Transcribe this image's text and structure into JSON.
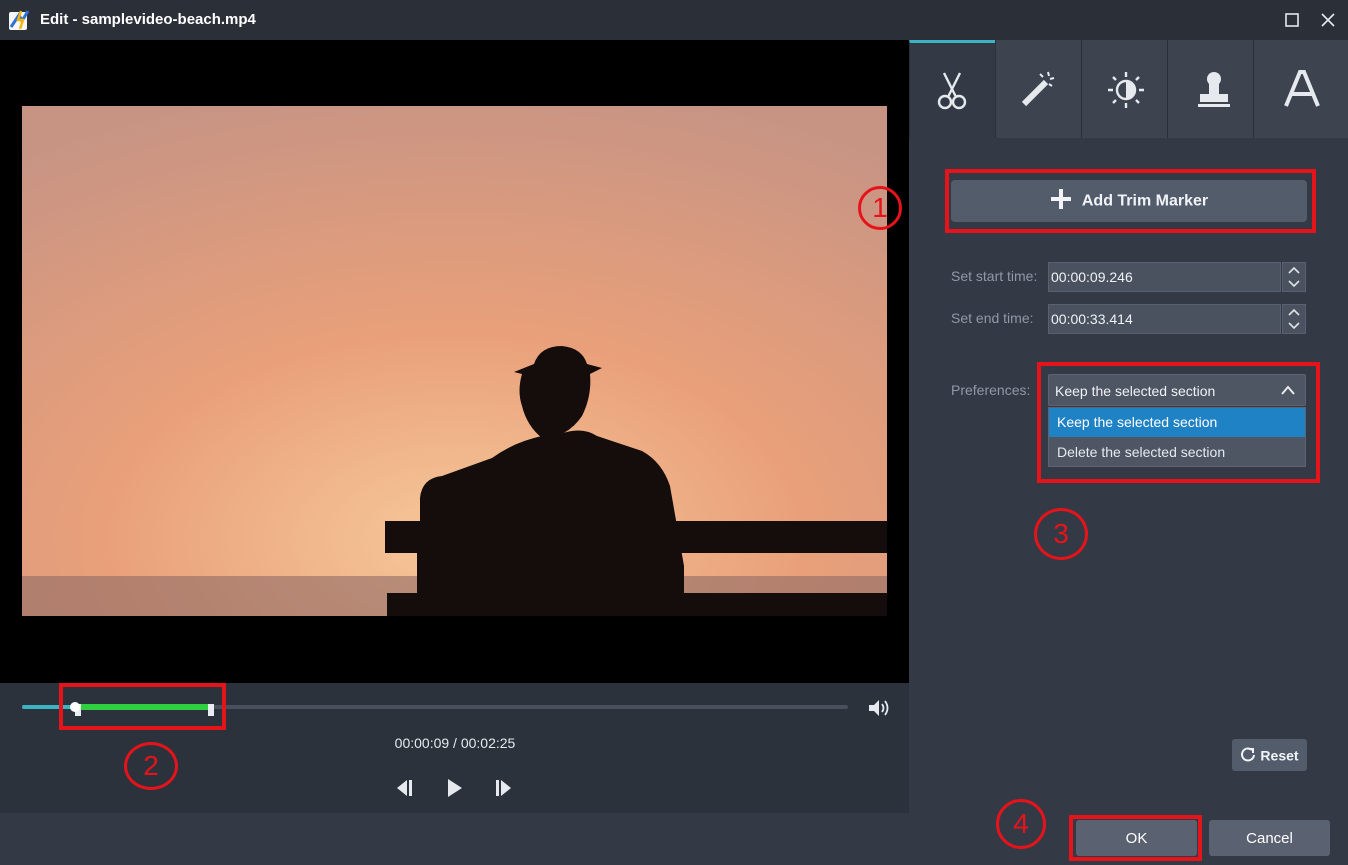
{
  "window": {
    "title": "Edit - samplevideo-beach.mp4"
  },
  "player": {
    "time_current": "00:00:09",
    "time_separator": "/",
    "time_total": "00:02:25",
    "played_fraction": 0.0625,
    "trim_start_fraction": 0.0636,
    "trim_end_fraction": 0.1657
  },
  "tabs": [
    {
      "icon": "scissors-icon"
    },
    {
      "icon": "magic-wand-icon"
    },
    {
      "icon": "brightness-icon"
    },
    {
      "icon": "stamp-icon"
    },
    {
      "icon": "text-icon"
    }
  ],
  "trim": {
    "add_marker_label": "Add Trim Marker",
    "start_label": "Set start time:",
    "start_value": "00:00:09.246",
    "end_label": "Set end time:",
    "end_value": "00:00:33.414",
    "preferences_label": "Preferences:",
    "selected_option": "Keep the selected section",
    "options": [
      "Keep the selected section",
      "Delete the selected section"
    ]
  },
  "buttons": {
    "reset": "Reset",
    "ok": "OK",
    "cancel": "Cancel"
  },
  "annotations": [
    "1",
    "2",
    "3",
    "4"
  ],
  "colors": {
    "accent": "#3ab4c4",
    "trim_selection": "#2ed040",
    "annotation": "#e6141a",
    "dropdown_highlight": "#1f82c4"
  }
}
